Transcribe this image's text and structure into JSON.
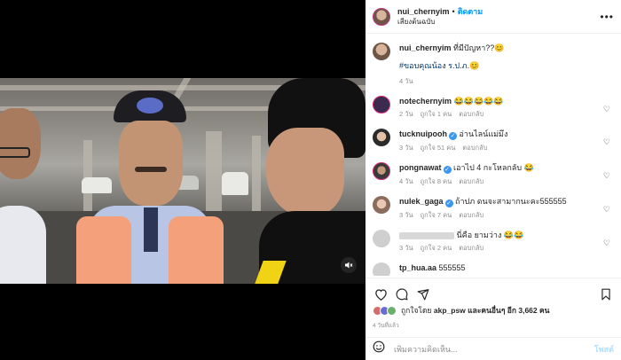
{
  "post": {
    "author": "nui_chernyim",
    "follow_label": "ติดตาม",
    "subtitle": "เสียงต้นฉบับ",
    "more_label": "•••"
  },
  "caption": {
    "username": "nui_chernyim",
    "text": "ที่มีปัญหา??😊",
    "hashtag": "#ขอบคุณน้อง ร.ป.ภ.😊",
    "time": "4 วัน"
  },
  "comments": [
    {
      "username": "notechernyim",
      "text": "😂😂😂😂😂",
      "time": "2 วัน",
      "likes": "ถูกใจ 1 คน",
      "reply": "ตอบกลับ",
      "verified": false
    },
    {
      "username": "tucknuipooh",
      "text": "อ่านไลน์แม่มึง",
      "time": "3 วัน",
      "likes": "ถูกใจ 51 คน",
      "reply": "ตอบกลับ",
      "verified": true
    },
    {
      "username": "pongnawat",
      "text": "เอาไป 4 กะโหลกลับ 😂",
      "time": "4 วัน",
      "likes": "ถูกใจ 8 คน",
      "reply": "ตอบกลับ",
      "verified": true
    },
    {
      "username": "nulek_gaga",
      "text": "ถ้าปภ ดนจะสามากนะคะ555555",
      "time": "3 วัน",
      "likes": "ถูกใจ 7 คน",
      "reply": "ตอบกลับ",
      "verified": true
    },
    {
      "username": "",
      "text": "นี่คือ ยามว่าง 😂😂",
      "time": "3 วัน",
      "likes": "ถูกใจ 2 คน",
      "reply": "ตอบกลับ",
      "verified": false
    },
    {
      "username": "tp_hua.aa",
      "text": "555555",
      "time": "",
      "likes": "",
      "reply": "",
      "verified": false
    }
  ],
  "likes": {
    "prefix": "ถูกใจโดย",
    "user": "akp_psw",
    "suffix": "และคนอื่นๆ อีก 3,662 คน"
  },
  "date": "4 วันที่แล้ว",
  "add_comment": {
    "placeholder": "เพิ่มความคิดเห็น...",
    "post_label": "โพสต์"
  },
  "colors": {
    "accent": "#0095f6",
    "verified": "#3897f0",
    "secondary_text": "#8e8e8e"
  },
  "icons": [
    "heart-icon",
    "comment-icon",
    "share-icon",
    "bookmark-icon",
    "emoji-icon",
    "mute-icon"
  ]
}
